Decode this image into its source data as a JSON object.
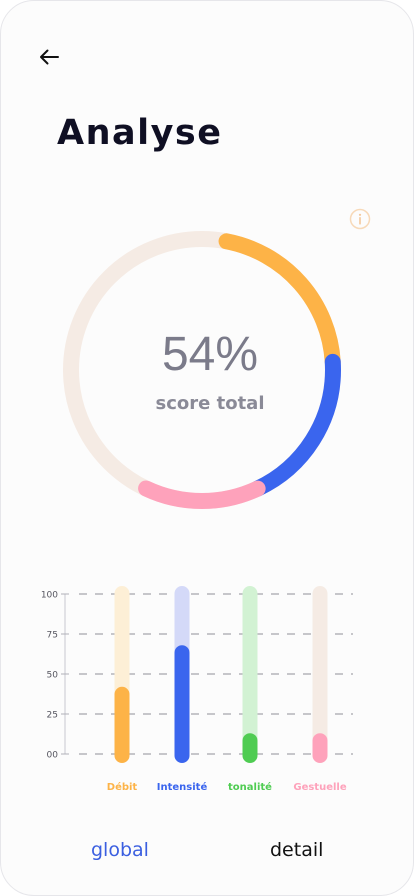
{
  "header": {
    "back_icon": "arrow-left-icon",
    "title": "Analyse",
    "info_icon": "info-icon"
  },
  "score": {
    "value": "54%",
    "label": "score total",
    "percent": 54
  },
  "chart_data": {
    "type": "bar",
    "categories": [
      "Débit",
      "Intensité",
      "tonalité",
      "Gestuelle"
    ],
    "values": [
      42,
      68,
      13,
      13
    ],
    "ylim": [
      0,
      100
    ],
    "y_ticks": [
      "00",
      "25",
      "50",
      "75",
      "100"
    ],
    "grid": true,
    "colors": [
      "#fdb347",
      "#3a65ee",
      "#4fcc52",
      "#fea2bb"
    ],
    "track_colors": [
      "#fdefd6",
      "#d4d9f8",
      "#d2f2d3",
      "#f5ebe4"
    ]
  },
  "donut": {
    "track_color": "#f5ebe4",
    "segments": [
      {
        "share": 0.21,
        "color": "#fdb347"
      },
      {
        "share": 0.19,
        "color": "#3a65ee"
      },
      {
        "share": 0.14,
        "color": "#fea2bb"
      }
    ]
  },
  "tabs": [
    {
      "label": "global",
      "active": true
    },
    {
      "label": "detail",
      "active": false
    }
  ]
}
